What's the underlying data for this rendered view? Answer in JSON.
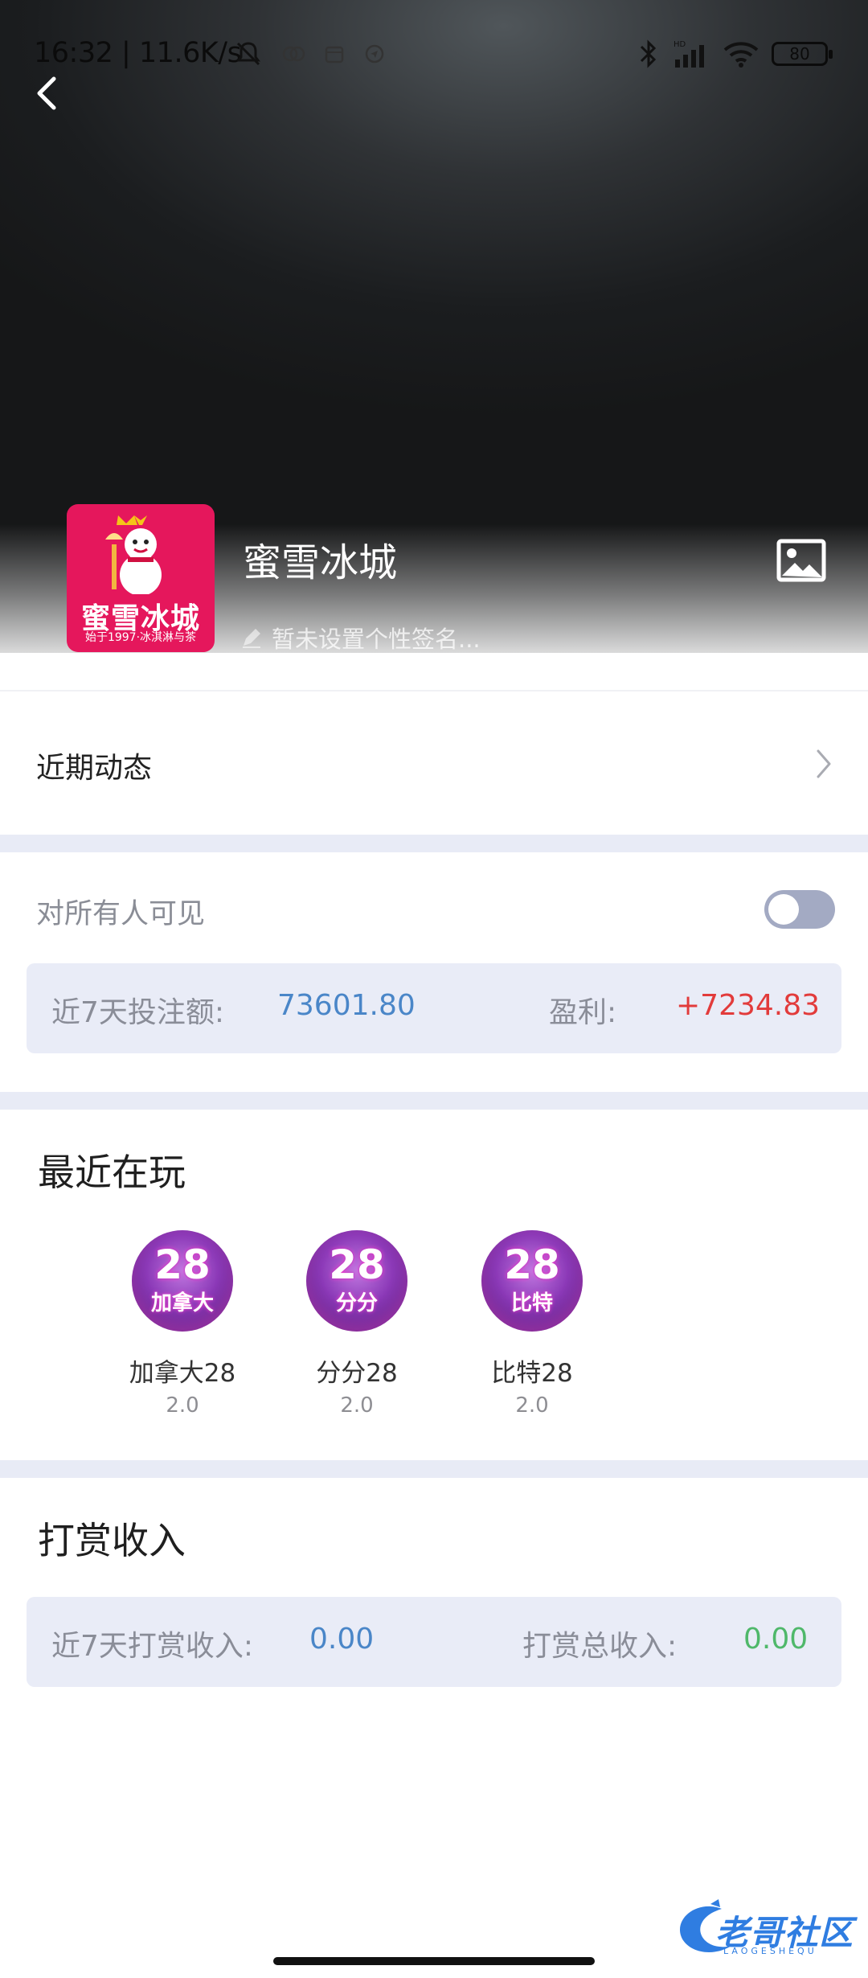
{
  "status_bar": {
    "time_and_speed": "16:32 | 11.6K/s",
    "battery": "80",
    "network_badge": "HD"
  },
  "profile": {
    "name": "蜜雪冰城",
    "signature_placeholder": "暂未设置个性签名...",
    "avatar": {
      "brand_text": "蜜雪冰城",
      "tagline": "始于1997·冰淇淋与茶",
      "background_color": "#e5175c"
    }
  },
  "recent_activity": {
    "label": "近期动态"
  },
  "visibility": {
    "label": "对所有人可见",
    "enabled": false
  },
  "bet_stats": {
    "amount_label": "近7天投注额:",
    "amount_value": "73601.80",
    "profit_label": "盈利:",
    "profit_value": "+7234.83"
  },
  "recently_played": {
    "title": "最近在玩",
    "games": [
      {
        "icon_number": "28",
        "icon_text": "加拿大",
        "name": "加拿大28",
        "version": "2.0"
      },
      {
        "icon_number": "28",
        "icon_text": "分分",
        "name": "分分28",
        "version": "2.0"
      },
      {
        "icon_number": "28",
        "icon_text": "比特",
        "name": "比特28",
        "version": "2.0"
      }
    ]
  },
  "tip_income": {
    "title": "打赏收入",
    "recent_label": "近7天打赏收入:",
    "recent_value": "0.00",
    "total_label": "打赏总收入:",
    "total_value": "0.00"
  },
  "watermark": {
    "text": "老哥社区",
    "subtext": "LAOGESHEQU"
  },
  "colors": {
    "accent_blue": "#4a86c8",
    "profit_red": "#e23b3b",
    "income_green": "#4fb86a",
    "section_band": "#e8ebf6",
    "card_bg": "#e9ecf7"
  }
}
